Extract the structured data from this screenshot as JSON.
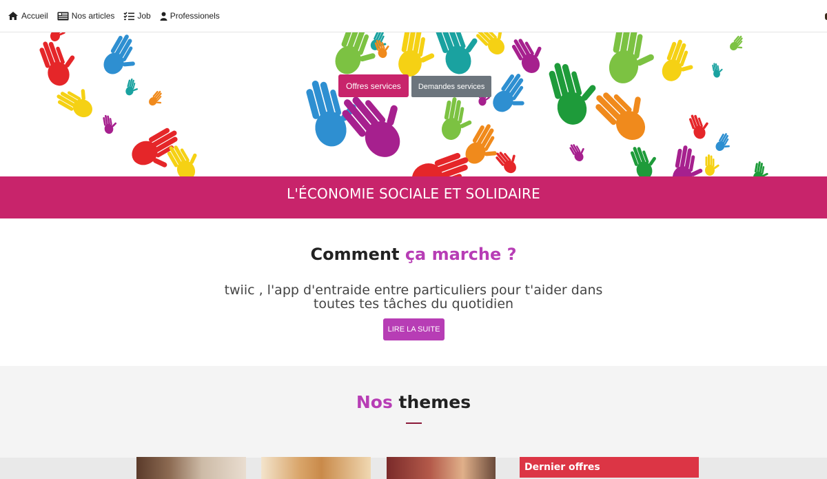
{
  "nav": {
    "items": [
      {
        "label": "Accueil",
        "icon": "home-icon"
      },
      {
        "label": "Nos articles",
        "icon": "newspaper-icon"
      },
      {
        "label": "Job",
        "icon": "checklist-icon"
      },
      {
        "label": "Professionels",
        "icon": "user-icon"
      }
    ]
  },
  "hero": {
    "offres_label": "Offres services",
    "demandes_label": "Demandes services"
  },
  "banner": {
    "text": "L'ÉCONOMIE SOCIALE ET SOLIDAIRE"
  },
  "how": {
    "title_part1": "Comment",
    "title_part2": "ça marche ?",
    "description": "twiic , l'app d'entraide entre particuliers pour t'aider dans toutes tes tâches du quotidien",
    "read_more": "LIRE LA SUITE"
  },
  "themes": {
    "title_part1": "Nos",
    "title_part2": "themes",
    "latest_offers": "Dernier offres"
  },
  "colors": {
    "primary": "#c8246b",
    "accent": "#b73db5",
    "grey_button": "#6c757d",
    "alert_red": "#dc3545",
    "hand_palette": [
      "#e52629",
      "#2e8fd1",
      "#7cc242",
      "#f5d114",
      "#f08a1c",
      "#a6208e",
      "#1aa2a0",
      "#1e9b3a"
    ]
  }
}
